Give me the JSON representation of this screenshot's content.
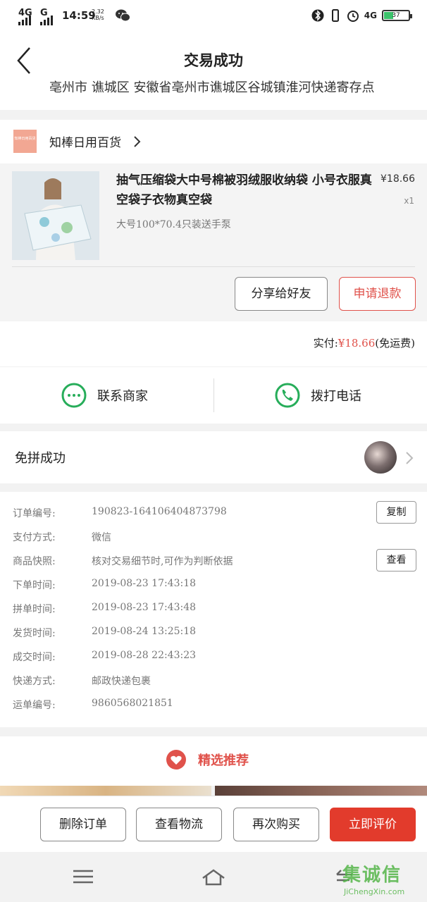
{
  "status_bar": {
    "signal_1": "4G",
    "signal_2": "G",
    "time": "14:59",
    "net_speed_value": "2.32",
    "net_speed_unit": "KB/s",
    "network_right": "4G",
    "battery": "37",
    "battery_level_percent": 37
  },
  "header": {
    "title": "交易成功",
    "clipped_address": "亳州市 谯城区 安徽省亳州市谯城区谷城镇淮河快递寄存点"
  },
  "shop": {
    "logo_text": "知棒日用百货",
    "name": "知棒日用百货"
  },
  "product": {
    "title": "抽气压缩袋大中号棉被羽绒服收纳袋 小号衣服真空袋子衣物真空袋",
    "price": "¥18.66",
    "quantity": "x1",
    "sku": "大号100*70.4只装送手泵"
  },
  "item_actions": {
    "share_label": "分享给好友",
    "refund_label": "申请退款"
  },
  "payment": {
    "prefix": "实付:",
    "amount": "¥18.66",
    "suffix": "(免运费)"
  },
  "contact": {
    "merchant_label": "联系商家",
    "call_label": "拨打电话"
  },
  "group": {
    "label": "免拼成功"
  },
  "order_details": {
    "order_no_key": "订单编号:",
    "order_no": "190823-164106404873798",
    "copy_label": "复制",
    "pay_method_key": "支付方式:",
    "pay_method": "微信",
    "snapshot_key": "商品快照:",
    "snapshot": "核对交易细节时,可作为判断依据",
    "view_label": "查看",
    "order_time_key": "下单时间:",
    "order_time": "2019-08-23  17:43:18",
    "group_time_key": "拼单时间:",
    "group_time": "2019-08-23  17:43:48",
    "ship_time_key": "发货时间:",
    "ship_time": "2019-08-24  13:25:18",
    "deal_time_key": "成交时间:",
    "deal_time": "2019-08-28  22:43:23",
    "express_key": "快递方式:",
    "express": "邮政快递包裹",
    "waybill_key": "运单编号:",
    "waybill": "9860568021851"
  },
  "recommend": {
    "title": "精选推荐"
  },
  "bottom_actions": {
    "delete_label": "删除订单",
    "logistics_label": "查看物流",
    "rebuy_label": "再次购买",
    "review_label": "立即评价"
  },
  "watermark": {
    "cn": "集诚信",
    "en": "JiChengXin.com"
  },
  "colors": {
    "accent": "#e0524b",
    "primary_button": "#e23b2c",
    "contact_green": "#27ad5a"
  }
}
